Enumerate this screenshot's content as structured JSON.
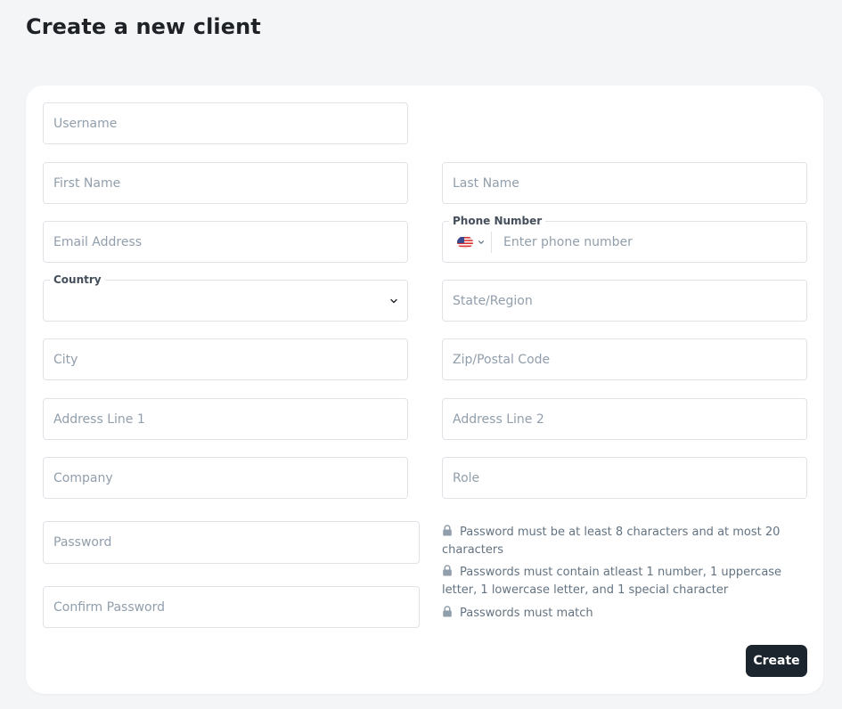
{
  "page": {
    "title": "Create a new client"
  },
  "form": {
    "username": {
      "placeholder": "Username",
      "value": ""
    },
    "first_name": {
      "placeholder": "First Name",
      "value": ""
    },
    "last_name": {
      "placeholder": "Last Name",
      "value": ""
    },
    "email": {
      "placeholder": "Email Address",
      "value": ""
    },
    "phone": {
      "label": "Phone Number",
      "placeholder": "Enter phone number",
      "value": "",
      "country_flag": "us-flag-icon"
    },
    "country": {
      "label": "Country",
      "value": ""
    },
    "state": {
      "placeholder": "State/Region",
      "value": ""
    },
    "city": {
      "placeholder": "City",
      "value": ""
    },
    "zip": {
      "placeholder": "Zip/Postal Code",
      "value": ""
    },
    "address1": {
      "placeholder": "Address Line 1",
      "value": ""
    },
    "address2": {
      "placeholder": "Address Line 2",
      "value": ""
    },
    "company": {
      "placeholder": "Company",
      "value": ""
    },
    "role": {
      "placeholder": "Role",
      "value": ""
    },
    "password": {
      "placeholder": "Password",
      "value": ""
    },
    "confirm_password": {
      "placeholder": "Confirm Password",
      "value": ""
    }
  },
  "password_rules": [
    {
      "text": "Password must be at least 8 characters and at most 20 characters",
      "icon": "lock-icon"
    },
    {
      "text": "Passwords must contain atleast 1 number, 1 uppercase letter, 1 lowercase letter, and 1 special character",
      "icon": "lock-icon"
    },
    {
      "text": "Passwords must match",
      "icon": "lock-icon"
    }
  ],
  "actions": {
    "create_label": "Create"
  },
  "colors": {
    "primary_button": "#1c252e",
    "placeholder": "#919eab",
    "border": "#dfe3e8",
    "background": "#f4f5f7"
  }
}
